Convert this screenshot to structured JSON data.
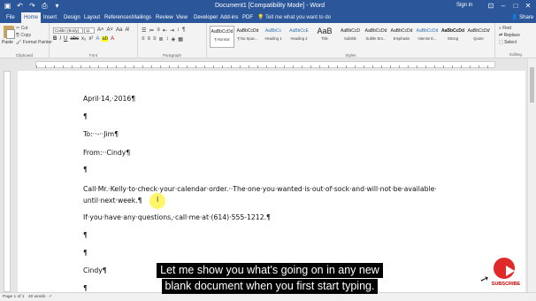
{
  "titlebar": {
    "title": "Document1 [Compatibility Mode] - Word",
    "signin": "Sign in",
    "qat_icons": [
      "save-icon",
      "undo-icon",
      "redo-icon",
      "print-icon",
      "customize-icon"
    ]
  },
  "tabs": [
    "File",
    "Home",
    "Insert",
    "Design",
    "Layout",
    "References",
    "Mailings",
    "Review",
    "View",
    "Developer",
    "Add-ins",
    "PDF"
  ],
  "tell_me": "Tell me what you want to do",
  "share": "Share",
  "ribbon": {
    "clipboard": {
      "paste": "Paste",
      "cut": "Cut",
      "copy": "Copy",
      "format_painter": "Format Painter",
      "label": "Clipboard"
    },
    "font": {
      "name": "Calibri (Body)",
      "size": "11",
      "label": "Font"
    },
    "paragraph": {
      "label": "Paragraph"
    },
    "styles": {
      "label": "Styles",
      "items": [
        {
          "preview": "AaBbCcDd",
          "name": "¶ Normal"
        },
        {
          "preview": "AaBbCcDd",
          "name": "¶ No Spac..."
        },
        {
          "preview": "AaBbCc",
          "name": "Heading 1"
        },
        {
          "preview": "AaBbCcE",
          "name": "Heading 2"
        },
        {
          "preview": "AaB",
          "name": "Title"
        },
        {
          "preview": "AaBbCcD",
          "name": "Subtitle"
        },
        {
          "preview": "AaBbCcDd",
          "name": "Subtle Em..."
        },
        {
          "preview": "AaBbCcDd",
          "name": "Emphasis"
        },
        {
          "preview": "AaBbCcDd",
          "name": "Intense E..."
        },
        {
          "preview": "AaBbCcDd",
          "name": "Strong"
        },
        {
          "preview": "AaBbCcDd",
          "name": "Quote"
        }
      ]
    },
    "editing": {
      "find": "Find",
      "replace": "Replace",
      "select": "Select",
      "label": "Editing"
    }
  },
  "document": {
    "lines": [
      "April·14,·2016¶",
      "¶",
      "To:··-··Jim¶",
      "From:··Cindy¶",
      "¶",
      "Call·Mr.·Kelly·to·check·your·calendar·order.··The·one·you·wanted·is·out·of·sock·and·will·not·be·available·",
      "until·next·week.¶",
      "If·you·have·any·questions,·call·me·at·(614)·555-1212.¶",
      "¶",
      "¶",
      "Cindy¶",
      "¶"
    ]
  },
  "status": {
    "page": "Page 1 of 1",
    "words": "40 words"
  },
  "caption": {
    "line1": "Let me show you what's going on in any new",
    "line2": "blank document when you first start typing."
  },
  "subscribe": "SUBSCRIBE"
}
